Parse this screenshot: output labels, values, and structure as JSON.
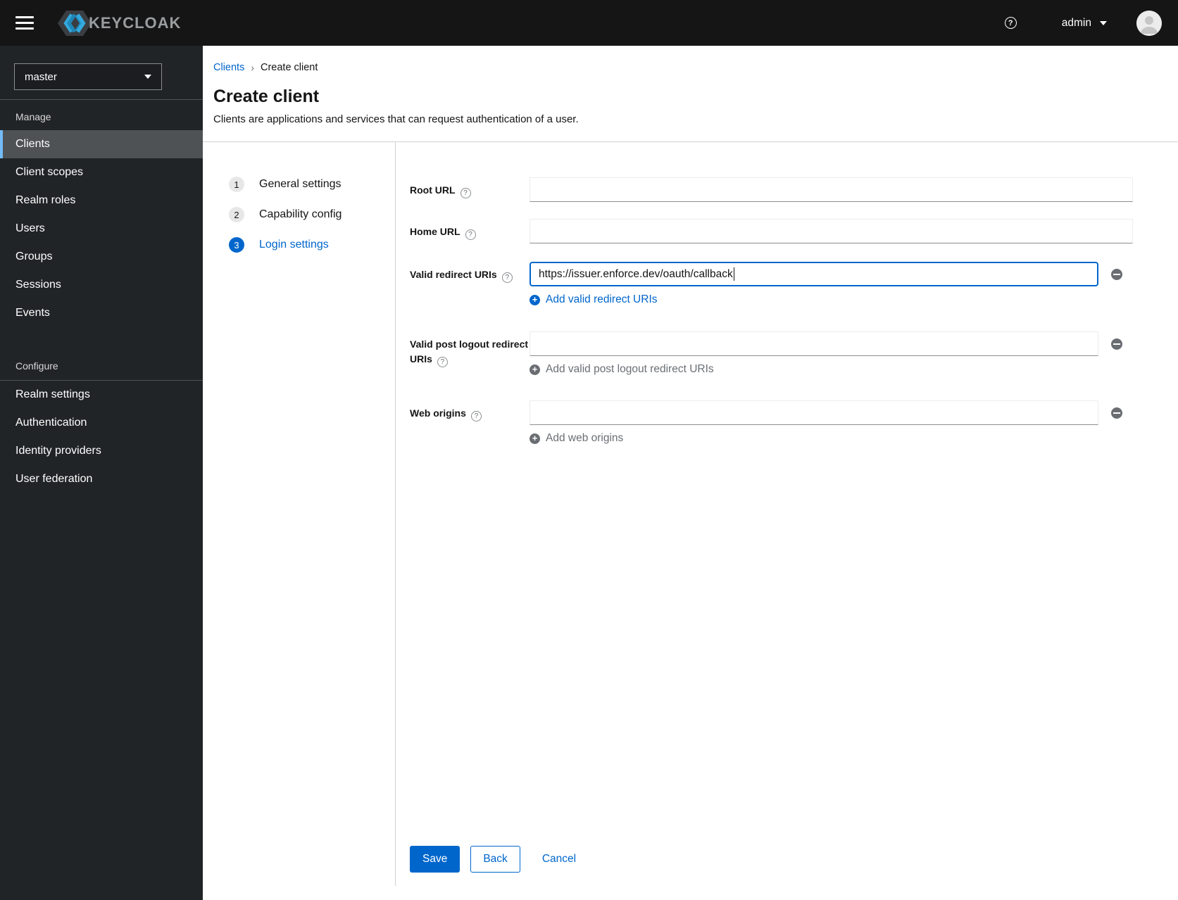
{
  "topbar": {
    "brand": "KEYCLOAK",
    "user": "admin"
  },
  "sidebar": {
    "realm_selector": {
      "value": "master"
    },
    "manage": {
      "title": "Manage",
      "items": [
        "Clients",
        "Client scopes",
        "Realm roles",
        "Users",
        "Groups",
        "Sessions",
        "Events"
      ],
      "selected": "Clients"
    },
    "configure": {
      "title": "Configure",
      "items": [
        "Realm settings",
        "Authentication",
        "Identity providers",
        "User federation"
      ]
    }
  },
  "breadcrumb": {
    "items": [
      "Clients",
      "Create client"
    ]
  },
  "page": {
    "title": "Create client",
    "description": "Clients are applications and services that can request authentication of a user."
  },
  "wizard": {
    "steps": [
      {
        "number": "1",
        "label": "General settings",
        "active": false
      },
      {
        "number": "2",
        "label": "Capability config",
        "active": false
      },
      {
        "number": "3",
        "label": "Login settings",
        "active": true
      }
    ]
  },
  "form": {
    "root_url": {
      "label": "Root URL",
      "value": ""
    },
    "home_url": {
      "label": "Home URL",
      "value": ""
    },
    "valid_redirect_uris": {
      "label": "Valid redirect URIs",
      "value": "https://issuer.enforce.dev/oauth/callback",
      "add_label": "Add valid redirect URIs"
    },
    "valid_post_logout_redirect_uris": {
      "label": "Valid post logout redirect URIs",
      "value": "",
      "add_label": "Add valid post logout redirect URIs"
    },
    "web_origins": {
      "label": "Web origins",
      "value": "",
      "add_label": "Add web origins"
    }
  },
  "actions": {
    "save": "Save",
    "back": "Back",
    "cancel": "Cancel"
  },
  "colors": {
    "accent_blue": "#0066cc",
    "nav_selected_border": "#73bcf7",
    "topbar_bg": "#151515",
    "sidebar_bg": "#212427"
  }
}
